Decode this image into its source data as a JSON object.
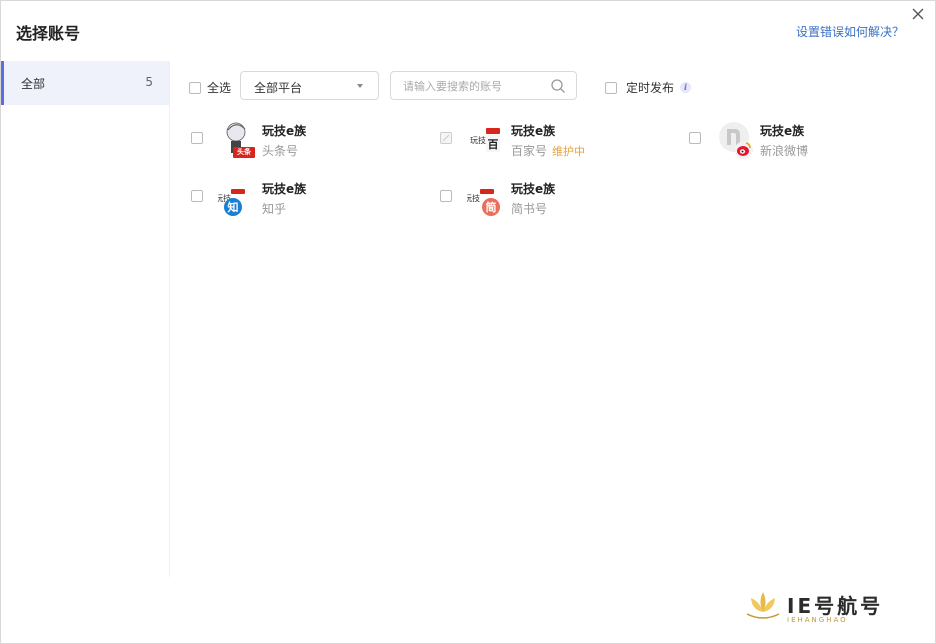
{
  "dialog": {
    "title": "选择账号",
    "help_link": "设置错误如何解决？",
    "close_icon": "close-icon"
  },
  "sidebar": {
    "items": [
      {
        "label": "全部",
        "count": "5"
      }
    ]
  },
  "toolbar": {
    "select_all": "全选",
    "platform_select": {
      "value": "全部平台"
    },
    "search": {
      "placeholder": "请输入要搜索的账号",
      "value": ""
    },
    "scheduled": "定时发布",
    "info_icon": "info-icon"
  },
  "accounts": [
    {
      "name": "玩技e族",
      "platform": "头条号",
      "status": "",
      "icon": "toutiao-icon"
    },
    {
      "name": "玩技e族",
      "platform": "百家号",
      "status": "维护中",
      "icon": "baijiahao-icon"
    },
    {
      "name": "玩技e族",
      "platform": "新浪微博",
      "status": "",
      "icon": "weibo-icon"
    },
    {
      "name": "玩技e族",
      "platform": "知乎",
      "status": "",
      "icon": "zhihu-icon"
    },
    {
      "name": "玩技e族",
      "platform": "简书号",
      "status": "",
      "icon": "jianshu-icon"
    }
  ],
  "badges": {
    "toutiao": "头条",
    "baijia": "百",
    "zhihu": "知",
    "jianshu": "简"
  },
  "watermark": {
    "text": "IE号航号",
    "sub": "IEHANGHAO"
  },
  "colors": {
    "accent": "#5b6fdd",
    "link": "#3a6fc4",
    "warning": "#e6a23c",
    "sidebar_active_bg": "#eff1fb"
  }
}
